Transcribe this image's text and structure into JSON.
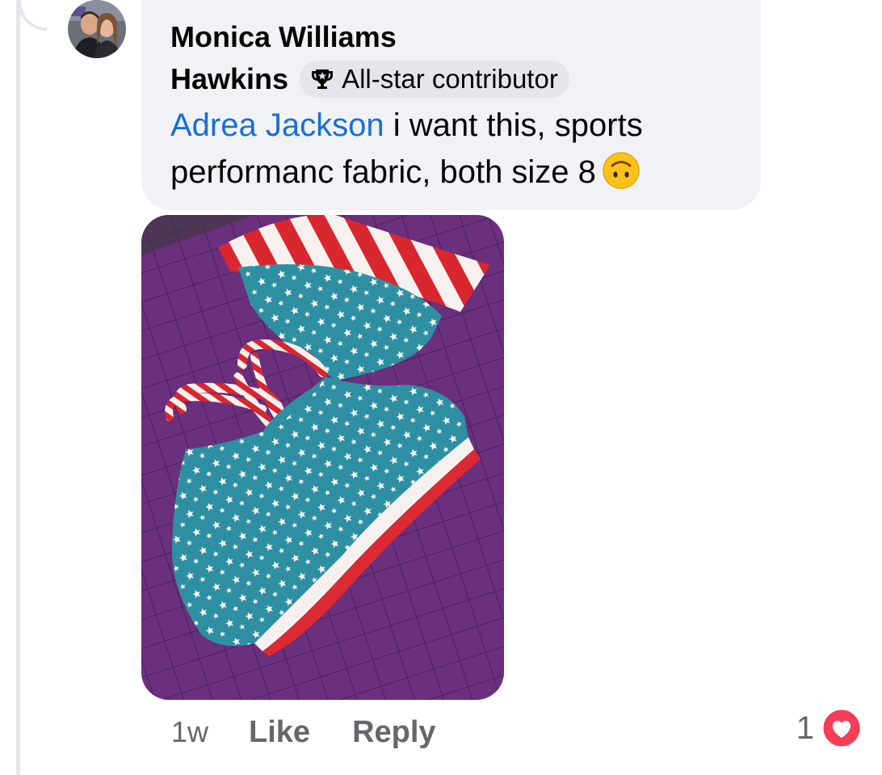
{
  "comment": {
    "author_line1": "Monica Williams",
    "author_line2": "Hawkins",
    "badge": {
      "icon": "trophy-icon",
      "label": "All-star contributor"
    },
    "mention": "Adrea Jackson",
    "text": " i want this, sports performanc fabric, both size 8",
    "emoji": "upside-down-face-emoji",
    "attachment": {
      "type": "photo",
      "description_icon": "photo-attachment"
    }
  },
  "actions": {
    "timestamp": "1w",
    "like_label": "Like",
    "reply_label": "Reply"
  },
  "reactions": {
    "count": "1",
    "icon": "love-reaction-icon",
    "color": "#f33e58"
  },
  "colors": {
    "bubble": "#f0f2f5",
    "mention": "#1a6ed8",
    "secondary_text": "#65676b",
    "badge_bg": "#e4e6eb"
  }
}
